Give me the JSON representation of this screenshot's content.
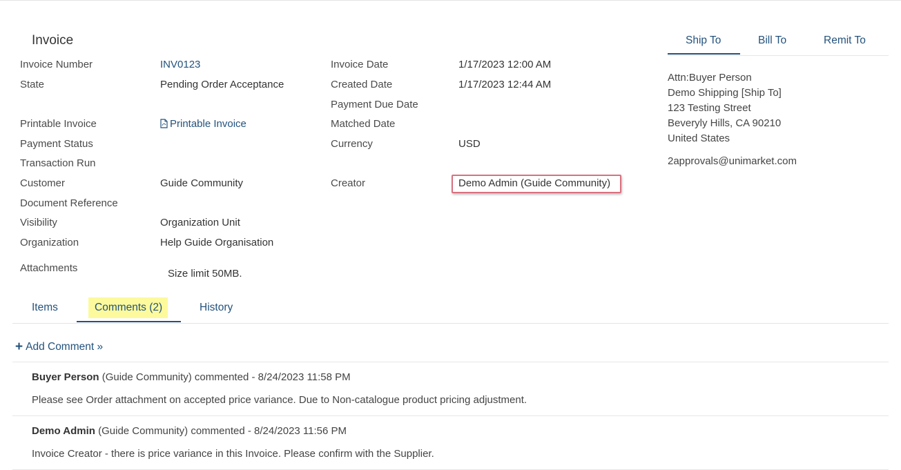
{
  "invoice": {
    "title": "Invoice",
    "left_fields": [
      {
        "label": "Invoice Number",
        "value": "INV0123"
      },
      {
        "label": "State",
        "value": "Pending Order Acceptance"
      },
      {
        "label": "Printable Invoice",
        "value": "Printable Invoice"
      },
      {
        "label": "Payment Status",
        "value": ""
      },
      {
        "label": "Transaction Run",
        "value": ""
      },
      {
        "label": "Customer",
        "value": "Guide Community"
      },
      {
        "label": "Document Reference",
        "value": ""
      },
      {
        "label": "Visibility",
        "value": "Organization Unit"
      },
      {
        "label": "Organization",
        "value": "Help Guide Organisation"
      },
      {
        "label": "Attachments",
        "value": "Size limit 50MB."
      }
    ],
    "mid_fields": [
      {
        "label": "Invoice Date",
        "value": "1/17/2023 12:00 AM"
      },
      {
        "label": "Created Date",
        "value": "1/17/2023 12:44 AM"
      },
      {
        "label": "Payment Due Date",
        "value": ""
      },
      {
        "label": "Matched Date",
        "value": ""
      },
      {
        "label": "Currency",
        "value": "USD"
      },
      {
        "label": "Creator",
        "value": "Demo Admin (Guide Community)"
      }
    ]
  },
  "address": {
    "tabs": [
      "Ship To",
      "Bill To",
      "Remit To"
    ],
    "active_tab": "Ship To",
    "lines": [
      "Attn:Buyer Person",
      "Demo Shipping [Ship To]",
      "123 Testing Street",
      "Beveryly Hills, CA 90210",
      "United States"
    ],
    "email": "2approvals@unimarket.com"
  },
  "tabs": {
    "items": [
      "Items",
      "Comments (2)",
      "History"
    ],
    "active": "Comments (2)"
  },
  "comments": {
    "add_label": "Add Comment »",
    "list": [
      {
        "author": "Buyer Person",
        "meta": " (Guide Community) commented - 8/24/2023 11:58 PM",
        "text": "Please see Order attachment on accepted price variance. Due to Non-catalogue product pricing adjustment."
      },
      {
        "author": "Demo Admin",
        "meta": " (Guide Community) commented - 8/24/2023 11:56 PM",
        "text": "Invoice Creator - there is price variance in this Invoice. Please confirm with the Supplier."
      }
    ]
  },
  "colors": {
    "link": "#23527c",
    "highlight": "#fcfa9c",
    "callout": "#d9707e"
  }
}
